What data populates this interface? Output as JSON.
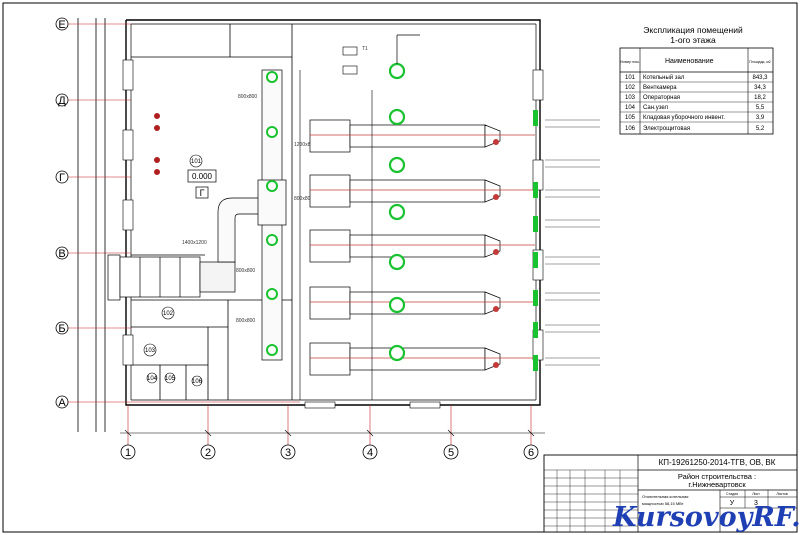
{
  "axes_rows": [
    {
      "label": "Е"
    },
    {
      "label": "Д"
    },
    {
      "label": "Г"
    },
    {
      "label": "В"
    },
    {
      "label": "Б"
    },
    {
      "label": "А"
    }
  ],
  "axes_cols": [
    {
      "label": "1"
    },
    {
      "label": "2"
    },
    {
      "label": "3"
    },
    {
      "label": "4"
    },
    {
      "label": "5"
    },
    {
      "label": "6"
    }
  ],
  "rooms": [
    "101",
    "102",
    "103",
    "104",
    "105",
    "106"
  ],
  "room_sym": "Г",
  "level_mark": "0.000",
  "duct_sizes": [
    "800х800",
    "1200х800",
    "1400х1200",
    "800х800",
    "800х800",
    "800х800"
  ],
  "pipe_tag": "Т1",
  "schedule": {
    "title_line1": "Экспликация помещений",
    "title_line2": "1-ого этажа",
    "col_no": "Номер пом.",
    "col_name": "Наименование",
    "col_area": "Площадь, м2",
    "rows": [
      {
        "no": "101",
        "name": "Котельный зал",
        "area": "843,3"
      },
      {
        "no": "102",
        "name": "Венткамера",
        "area": "34,3"
      },
      {
        "no": "103",
        "name": "Операторная",
        "area": "18,2"
      },
      {
        "no": "104",
        "name": "Сан.узел",
        "area": "5,5"
      },
      {
        "no": "105",
        "name": "Кладовая уборочного инвент.",
        "area": "3,9"
      },
      {
        "no": "106",
        "name": "Электрощитовая",
        "area": "5,2"
      }
    ]
  },
  "title_block": {
    "code": "КП-19261250-2014-ТГВ, ОВ, ВК",
    "location_line1": "Район строительства :",
    "location_line2": "г.Нижневартовск",
    "sheet_name_line1": "Отопительная котельная",
    "sheet_name_line2": "мощностью 58,15 МВт",
    "col_stage": "Стадия",
    "col_sheet": "Лист",
    "col_sheets": "Листов",
    "stage": "У",
    "sheet_no": "3"
  },
  "watermark": {
    "text": "KursovoyRF.ru",
    "color_blue": "#1f3fb4",
    "color_red": "#d22b2b"
  },
  "colors": {
    "line": "#000000",
    "axis_red": "#c4211e",
    "pipe_red": "#c43a3a",
    "green": "#19c22f",
    "gray": "#6f6f6f"
  }
}
